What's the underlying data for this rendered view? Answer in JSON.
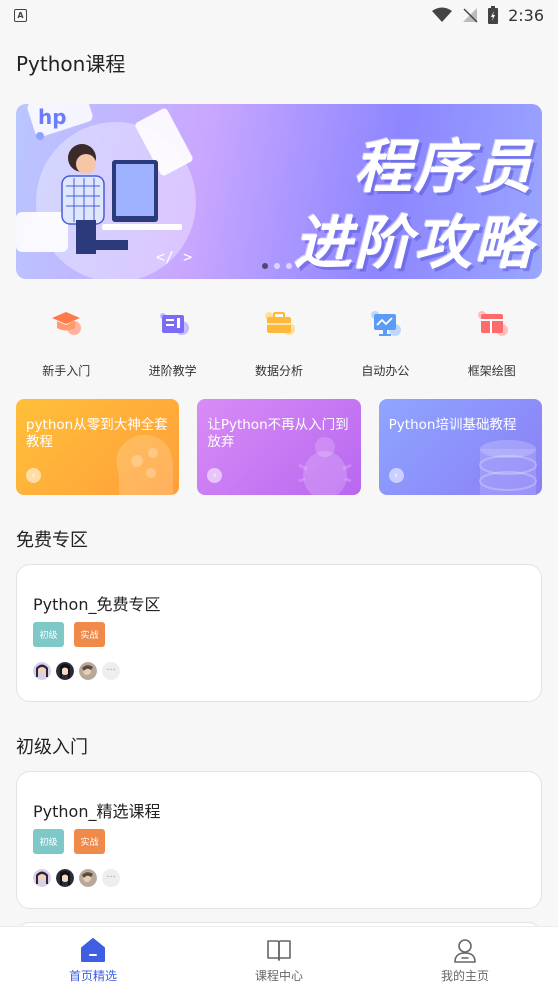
{
  "status_bar": {
    "time": "2:36"
  },
  "header": {
    "title": "Python课程"
  },
  "banner": {
    "line1": "程序员",
    "line2": "进阶攻略",
    "slide_count": 3,
    "active_slide": 1
  },
  "categories": [
    {
      "label": "新手入门",
      "icon": "graduation-cap-icon",
      "color": "#ff8a5c"
    },
    {
      "label": "进阶教学",
      "icon": "book-icon",
      "color": "#7b6cf6"
    },
    {
      "label": "数据分析",
      "icon": "briefcase-icon",
      "color": "#ffb93a"
    },
    {
      "label": "自动办公",
      "icon": "monitor-icon",
      "color": "#5a9cf8"
    },
    {
      "label": "框架绘图",
      "icon": "layout-icon",
      "color": "#ff6b6b"
    }
  ],
  "course_cards": [
    {
      "title": "python从零到大神全套教程"
    },
    {
      "title": "让Python不再从入门到放弃"
    },
    {
      "title": "Python培训基础教程"
    }
  ],
  "sections": [
    {
      "title": "免费专区",
      "card": {
        "title": "Python_免费专区",
        "tags": [
          "初级",
          "实战"
        ]
      }
    },
    {
      "title": "初级入门",
      "card": {
        "title": "Python_精选课程",
        "tags": [
          "初级",
          "实战"
        ]
      }
    }
  ],
  "avatar_more": "···",
  "bottom_nav": [
    {
      "label": "首页精选",
      "icon": "home-icon",
      "active": true
    },
    {
      "label": "课程中心",
      "icon": "open-book-icon",
      "active": false
    },
    {
      "label": "我的主页",
      "icon": "user-icon",
      "active": false
    }
  ],
  "colors": {
    "accent": "#3f5fe0",
    "tag_level": "#7ec8c8",
    "tag_type": "#f08a4b"
  }
}
